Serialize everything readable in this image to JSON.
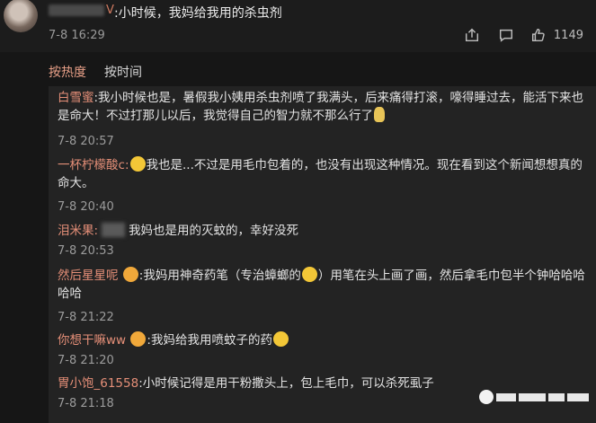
{
  "post": {
    "author_tail": "V",
    "text": ":小时候，我妈给我用的杀虫剂",
    "time": "7-8 16:29",
    "like_count": "1149",
    "icons": [
      "share-icon",
      "comment-icon",
      "like-icon"
    ]
  },
  "tabs": [
    {
      "label": "按热度"
    },
    {
      "label": "按时间"
    }
  ],
  "replies": [
    {
      "name": "白雪蜜",
      "text": ":我小时候也是，暑假我小姨用杀虫剂喷了我满头，后来痛得打滚，嚎得睡过去，能活下来也是命大！不过打那儿以后，我觉得自己的智力就不那么行了",
      "time": "7-8 20:57"
    },
    {
      "name": "一杯柠檬酸c",
      "text": "我也是...不过是用毛巾包着的，也没有出现这种情况。现在看到这个新闻想想真的命大。",
      "time": "7-8 20:40"
    },
    {
      "name": "泪米果:",
      "text": "我妈也是用的灭蚊的，幸好没死",
      "time": "7-8 20:53"
    },
    {
      "name": "然后星星呢",
      "text1": ":我妈用神奇药笔（专治蟑螂的",
      "text2": "）用笔在头上画了画，然后拿毛巾包半个钟哈哈哈哈哈",
      "time": "7-8 21:22"
    },
    {
      "name": "你想干嘛ww",
      "text": ":我妈给我用喷蚊子的药",
      "time": "7-8 21:20"
    },
    {
      "name": "胃小饱_61558",
      "text": ":小时候记得是用干粉撒头上，包上毛巾，可以杀死虱子",
      "time": "7-8 21:18"
    }
  ],
  "colors": {
    "accent": "#e58f78",
    "background": "#161616",
    "thread_bg": "#232323"
  }
}
